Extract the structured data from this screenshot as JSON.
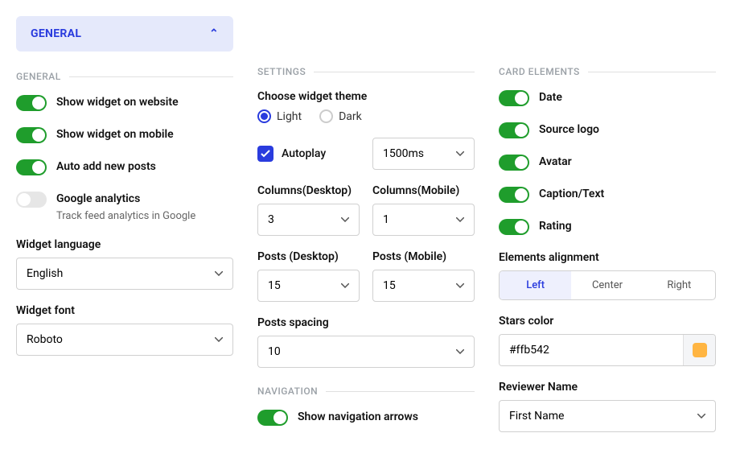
{
  "accordion": {
    "title": "GENERAL"
  },
  "col1": {
    "section": "GENERAL",
    "toggles": [
      {
        "label": "Show widget on website",
        "on": true
      },
      {
        "label": "Show widget on mobile",
        "on": true
      },
      {
        "label": "Auto add new posts",
        "on": true
      },
      {
        "label": "Google analytics",
        "desc": "Track feed analytics in Google",
        "on": false
      }
    ],
    "language": {
      "label": "Widget language",
      "value": "English"
    },
    "font": {
      "label": "Widget font",
      "value": "Roboto"
    }
  },
  "col2": {
    "section": "SETTINGS",
    "theme": {
      "label": "Choose widget theme",
      "options": [
        "Light",
        "Dark"
      ],
      "selected": "Light"
    },
    "autoplay": {
      "label": "Autoplay",
      "checked": true,
      "value": "1500ms"
    },
    "cols_desktop": {
      "label": "Columns(Desktop)",
      "value": "3"
    },
    "cols_mobile": {
      "label": "Columns(Mobile)",
      "value": "1"
    },
    "posts_desktop": {
      "label": "Posts (Desktop)",
      "value": "15"
    },
    "posts_mobile": {
      "label": "Posts (Mobile)",
      "value": "15"
    },
    "spacing": {
      "label": "Posts spacing",
      "value": "10"
    },
    "nav": {
      "section": "NAVIGATION",
      "arrows": {
        "label": "Show navigation arrows",
        "on": true
      }
    }
  },
  "col3": {
    "section": "CARD ELEMENTS",
    "toggles": {
      "date": "Date",
      "source_logo": "Source logo",
      "avatar": "Avatar",
      "caption": "Caption/Text",
      "rating": "Rating"
    },
    "alignment": {
      "label": "Elements alignment",
      "options": [
        "Left",
        "Center",
        "Right"
      ],
      "selected": "Left"
    },
    "stars_color": {
      "label": "Stars color",
      "value": "#ffb542"
    },
    "reviewer": {
      "label": "Reviewer Name",
      "value": "First Name"
    }
  }
}
